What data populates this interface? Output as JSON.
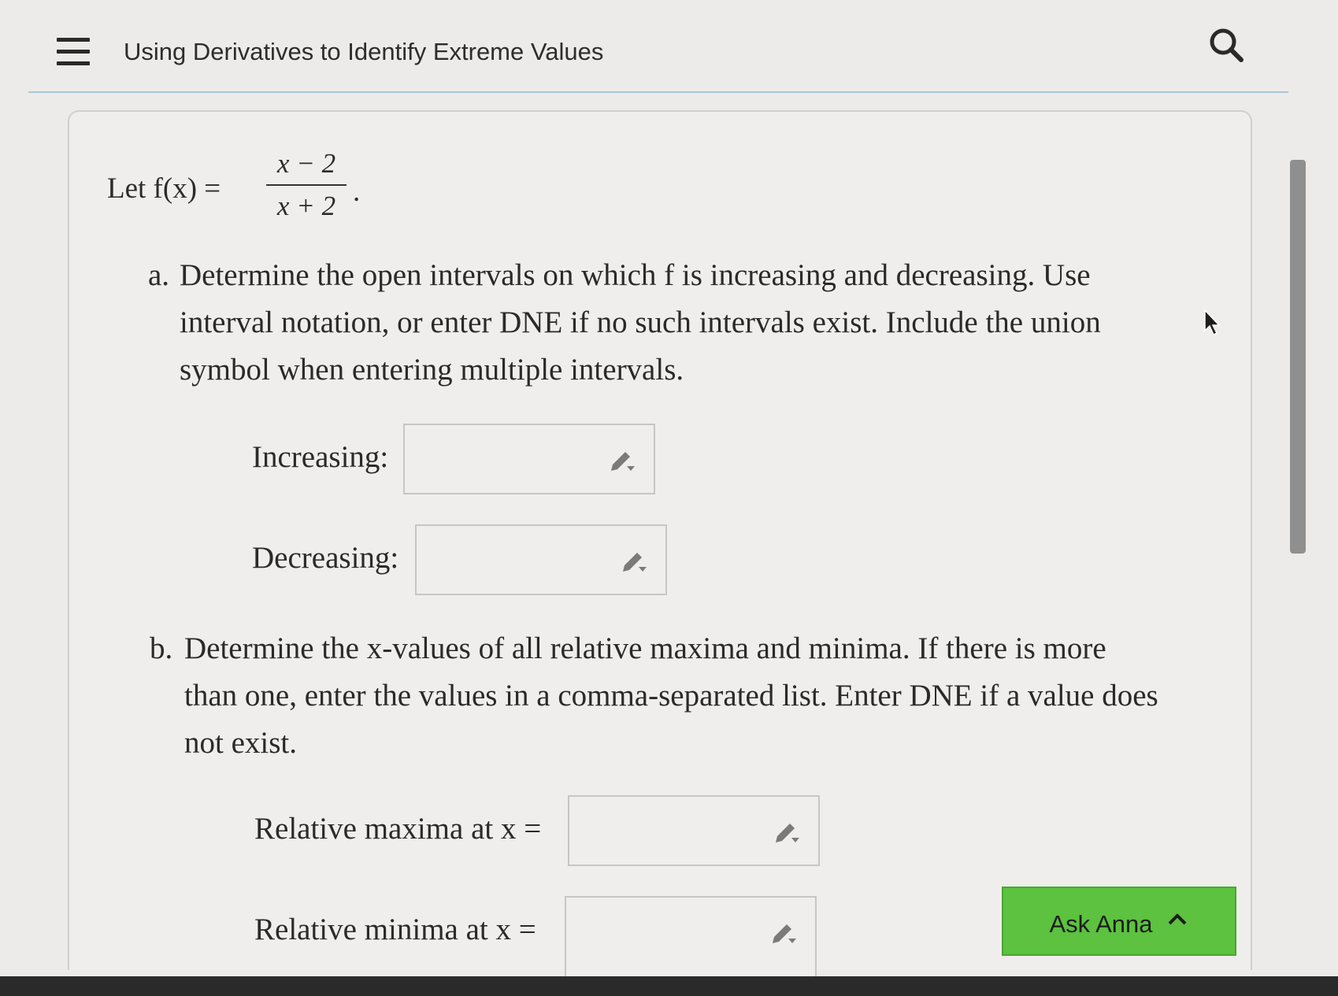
{
  "header": {
    "title": "Using Derivatives to Identify Extreme Values",
    "menu_icon": "hamburger-menu-icon",
    "search_icon": "search-icon"
  },
  "problem": {
    "intro_prefix": "Let f(x) =",
    "numerator": "x − 2",
    "denominator": "x + 2",
    "period": ".",
    "part_a": {
      "marker": "a.",
      "text_lines": [
        "Determine the open intervals on which f is increasing and decreasing. Use",
        "interval notation, or enter DNE if no such intervals exist. Include the union",
        "symbol when entering multiple intervals."
      ],
      "increasing_label": "Increasing:",
      "decreasing_label": "Decreasing:"
    },
    "part_b": {
      "marker": "b.",
      "text_lines": [
        "Determine the x-values of all relative maxima and minima. If there is more",
        "than one, enter the values in a comma-separated list. Enter DNE if a value does",
        "not exist."
      ],
      "maxima_label": "Relative maxima at x =",
      "minima_label": "Relative minima at x ="
    }
  },
  "inputs": {
    "increasing": "",
    "decreasing": "",
    "maxima": "",
    "minima": ""
  },
  "ask_button": {
    "label": "Ask Anna",
    "icon": "chevron-up-icon"
  },
  "colors": {
    "accent_green": "#5cc23f",
    "divider_blue": "#a9c7d6"
  }
}
